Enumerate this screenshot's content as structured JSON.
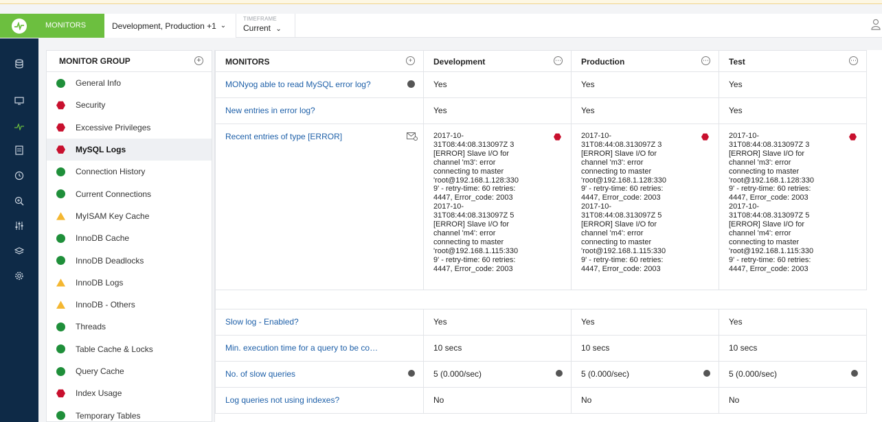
{
  "topbar": {
    "monitors_tab": "MONITORS",
    "environments": "Development, Production +1",
    "timeframe_label": "TIMEFRAME",
    "timeframe_value": "Current"
  },
  "rail_icons": [
    "database-icon",
    "monitor-icon",
    "pulse-icon",
    "document-icon",
    "clock-icon",
    "zoom-icon",
    "sliders-icon",
    "layers-icon",
    "gear-icon"
  ],
  "group_panel": {
    "header": "MONITOR GROUP",
    "items": [
      {
        "label": "General Info",
        "status": "green"
      },
      {
        "label": "Security",
        "status": "red"
      },
      {
        "label": "Excessive Privileges",
        "status": "red"
      },
      {
        "label": "MySQL Logs",
        "status": "red",
        "active": true
      },
      {
        "label": "Connection History",
        "status": "green"
      },
      {
        "label": "Current Connections",
        "status": "green"
      },
      {
        "label": "MyISAM Key Cache",
        "status": "yellow"
      },
      {
        "label": "InnoDB Cache",
        "status": "green"
      },
      {
        "label": "InnoDB Deadlocks",
        "status": "green"
      },
      {
        "label": "InnoDB Logs",
        "status": "yellow"
      },
      {
        "label": "InnoDB - Others",
        "status": "yellow"
      },
      {
        "label": "Threads",
        "status": "green"
      },
      {
        "label": "Table Cache & Locks",
        "status": "green"
      },
      {
        "label": "Query Cache",
        "status": "green"
      },
      {
        "label": "Index Usage",
        "status": "red"
      },
      {
        "label": "Temporary Tables",
        "status": "green"
      }
    ]
  },
  "monitors_table": {
    "headers": [
      "MONITORS",
      "Development",
      "Production",
      "Test"
    ],
    "rows": [
      {
        "name": "MONyog able to read MySQL error log?",
        "values": [
          "Yes",
          "Yes",
          "Yes"
        ]
      },
      {
        "name": "New entries in error log?",
        "values": [
          "Yes",
          "Yes",
          "Yes"
        ]
      },
      {
        "name": "Recent entries of type [ERROR]",
        "values": [
          "2017-10-\n31T08:44:08.313097Z 3\n[ERROR] Slave I/O for\nchannel 'm3': error\nconnecting to master\n'root@192.168.1.128:330\n9' - retry-time: 60  retries:\n4447, Error_code: 2003\n2017-10-\n31T08:44:08.313097Z 5\n[ERROR] Slave I/O for\nchannel 'm4': error\nconnecting to master\n'root@192.168.1.115:330\n9' - retry-time: 60  retries:\n4447, Error_code: 2003",
          "2017-10-\n31T08:44:08.313097Z 3\n[ERROR] Slave I/O for\nchannel 'm3': error\nconnecting to master\n'root@192.168.1.128:330\n9' - retry-time: 60  retries:\n4447, Error_code: 2003\n2017-10-\n31T08:44:08.313097Z 5\n[ERROR] Slave I/O for\nchannel 'm4': error\nconnecting to master\n'root@192.168.1.115:330\n9' - retry-time: 60  retries:\n4447, Error_code: 2003",
          "2017-10-\n31T08:44:08.313097Z 3\n[ERROR] Slave I/O for\nchannel 'm3': error\nconnecting to master\n'root@192.168.1.128:330\n9' - retry-time: 60  retries:\n4447, Error_code: 2003\n2017-10-\n31T08:44:08.313097Z 5\n[ERROR] Slave I/O for\nchannel 'm4': error\nconnecting to master\n'root@192.168.1.115:330\n9' - retry-time: 60  retries:\n4447, Error_code: 2003"
        ]
      },
      {
        "name": "Slow log - Enabled?",
        "values": [
          "Yes",
          "Yes",
          "Yes"
        ]
      },
      {
        "name": "Min. execution time for a query to be co…",
        "values": [
          "10 secs",
          "10 secs",
          "10 secs"
        ]
      },
      {
        "name": "No. of slow queries",
        "values": [
          "5 (0.000/sec)",
          "5 (0.000/sec)",
          "5 (0.000/sec)"
        ]
      },
      {
        "name": "Log queries not using indexes?",
        "values": [
          "No",
          "No",
          "No"
        ]
      }
    ]
  },
  "colors": {
    "accent_green": "#6cbf3f",
    "rail_navy": "#0e2a47",
    "link_blue": "#1d5fa8",
    "status_green": "#1f8f3a",
    "status_red": "#c8102e",
    "status_yellow": "#f4b731"
  }
}
